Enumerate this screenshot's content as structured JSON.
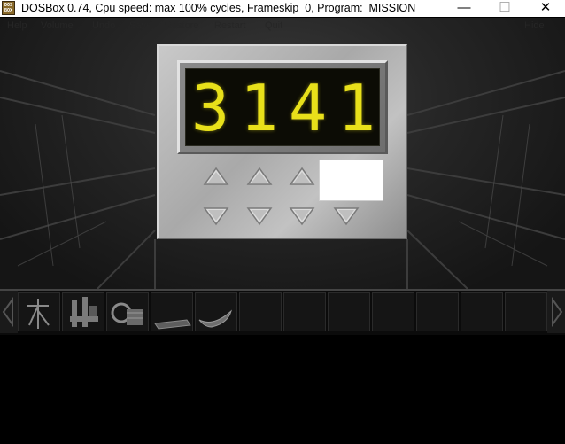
{
  "window": {
    "icon_label": "DOS BOX",
    "title": "DOSBox 0.74, Cpu speed: max 100% cycles, Frameskip  0, Program:  MISSION",
    "minimize_glyph": "—",
    "maximize_glyph": "☐",
    "close_glyph": "✕"
  },
  "menu": {
    "items": [
      "Help",
      "Volume",
      "Undo",
      "Save",
      "Restore",
      "Restart",
      "Quit"
    ],
    "right": "Hide"
  },
  "keypad": {
    "digits": [
      "3",
      "1",
      "4",
      "1"
    ],
    "digit_color": "#e8e01a",
    "up_buttons": 3,
    "down_buttons": 4
  },
  "inventory": {
    "items": [
      "crane-tool-icon",
      "machine-part-icon",
      "coil-device-icon",
      "flat-board-icon",
      "curved-blade-icon"
    ],
    "empty_slots": 7
  }
}
